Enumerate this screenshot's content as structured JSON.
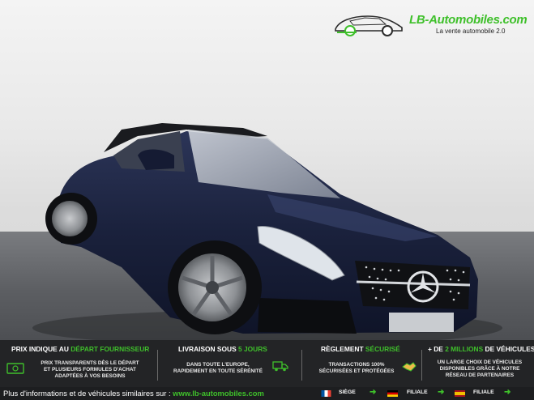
{
  "logo": {
    "title": "LB-Automobiles.com",
    "tagline": "La vente automobile 2.0"
  },
  "banner": {
    "col1": {
      "title_a": "PRIX INDIQUE AU ",
      "title_b": "DÉPART FOURNISSEUR",
      "line1": "PRIX TRANSPARENTS DÈS LE DÉPART",
      "line2": "ET PLUSIEURS FORMULES D'ACHAT",
      "line3": "ADAPTÉES À VOS BESOINS"
    },
    "col2": {
      "title_a": "LIVRAISON SOUS ",
      "title_b": "5 JOURS",
      "line1": "DANS TOUTE L'EUROPE,",
      "line2": "RAPIDEMENT EN TOUTE SÉRÉNITÉ"
    },
    "col3": {
      "title_a": "RÈGLEMENT ",
      "title_b": "SÉCURISÉ",
      "line1": "TRANSACTIONS 100%",
      "line2": "SÉCURISÉES ET PROTÉGÉES"
    },
    "col4": {
      "title_a": "+ DE ",
      "title_b": "2 MILLIONS",
      "title_c": " DE VÉHICULES",
      "line1": "UN LARGE CHOIX DE VÉHICULES",
      "line2": "DISPONIBLES GRÂCE À NOTRE",
      "line3": "RÉSEAU DE PARTENAIRES"
    }
  },
  "footer": {
    "text": "Plus d'informations et de véhicules similaires sur : ",
    "url": "www.lb-automobiles.com",
    "flags": [
      {
        "label": "SIÈGE",
        "country": "France"
      },
      {
        "label": "FILIALE",
        "country": "Germany"
      },
      {
        "label": "FILIALE",
        "country": "Spain"
      }
    ]
  },
  "colors": {
    "accent": "#3fc02b",
    "banner_bg": "#232426",
    "car_body": "#1b2340"
  }
}
